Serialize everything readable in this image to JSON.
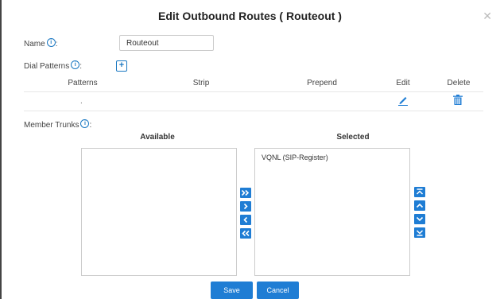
{
  "dialog": {
    "title": "Edit Outbound Routes ( Routeout )",
    "close_icon": "close-icon"
  },
  "name_field": {
    "label": "Name",
    "colon": ":",
    "value": "Routeout"
  },
  "dial_patterns": {
    "label": "Dial Patterns",
    "colon": ":",
    "add_label": "+",
    "columns": {
      "patterns": "Patterns",
      "strip": "Strip",
      "prepend": "Prepend",
      "edit": "Edit",
      "delete": "Delete"
    },
    "rows": [
      {
        "pattern": ".",
        "strip": "",
        "prepend": ""
      }
    ]
  },
  "member_trunks": {
    "label": "Member Trunks",
    "colon": ":",
    "available_header": "Available",
    "selected_header": "Selected",
    "available_items": [],
    "selected_items": [
      "VQNL (SIP-Register)"
    ]
  },
  "footer": {
    "save_label": "Save",
    "cancel_label": "Cancel"
  },
  "colors": {
    "accent": "#1f7dd4",
    "info_icon": "#1a78c2"
  }
}
